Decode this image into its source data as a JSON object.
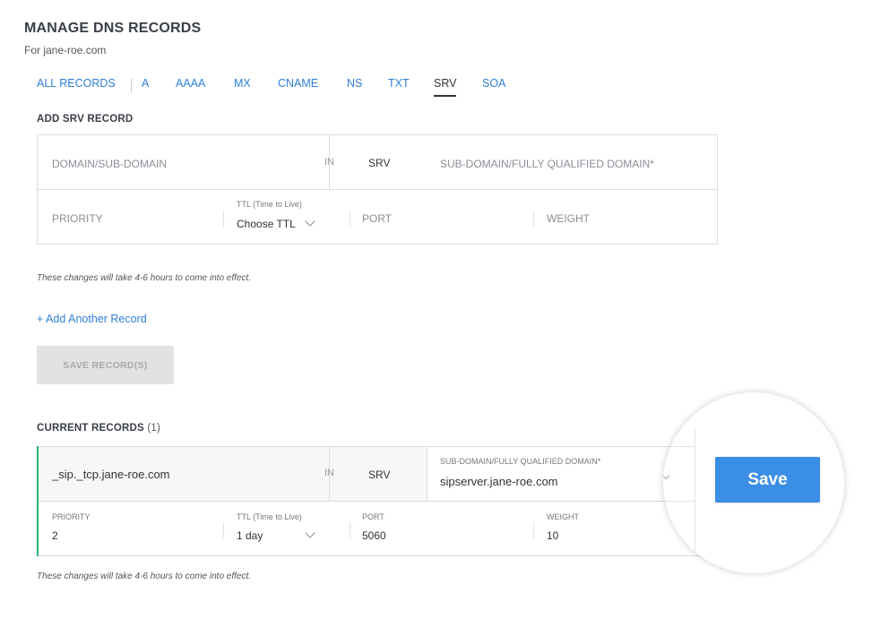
{
  "header": {
    "title": "MANAGE DNS RECORDS",
    "subtitle": "For jane-roe.com"
  },
  "tabs": [
    {
      "label": "ALL RECORDS"
    },
    {
      "label": "A"
    },
    {
      "label": "AAAA"
    },
    {
      "label": "MX"
    },
    {
      "label": "CNAME"
    },
    {
      "label": "NS"
    },
    {
      "label": "TXT"
    },
    {
      "label": "SRV",
      "active": true
    },
    {
      "label": "SOA"
    }
  ],
  "add_record": {
    "title": "ADD SRV RECORD",
    "domain_placeholder": "DOMAIN/SUB-DOMAIN",
    "in_label": "IN",
    "type": "SRV",
    "target_placeholder": "SUB-DOMAIN/FULLY QUALIFIED DOMAIN*",
    "priority_placeholder": "PRIORITY",
    "ttl_label": "TTL (Time to Live)",
    "ttl_value": "Choose TTL",
    "port_placeholder": "PORT",
    "weight_placeholder": "WEIGHT",
    "note": "These changes will take 4-6 hours to come into effect.",
    "add_another": "+ Add Another Record",
    "save_label": "SAVE RECORD(S)"
  },
  "current_records": {
    "title": "CURRENT RECORDS",
    "count": "(1)",
    "record": {
      "domain": "_sip._tcp.jane-roe.com",
      "in_label": "IN",
      "type": "SRV",
      "target_label": "SUB-DOMAIN/FULLY QUALIFIED DOMAIN*",
      "target_value": "sipserver.jane-roe.com",
      "priority_label": "PRIORITY",
      "priority_value": "2",
      "ttl_label": "TTL (Time to Live)",
      "ttl_value": "1 day",
      "port_label": "PORT",
      "port_value": "5060",
      "weight_label": "WEIGHT",
      "weight_value": "10"
    },
    "note": "These changes will take 4-6 hours to come into effect.",
    "save_button": "Save"
  },
  "colors": {
    "link": "#2f80d8",
    "accent_green": "#2bb673",
    "save_blue": "#3a8ee6"
  }
}
